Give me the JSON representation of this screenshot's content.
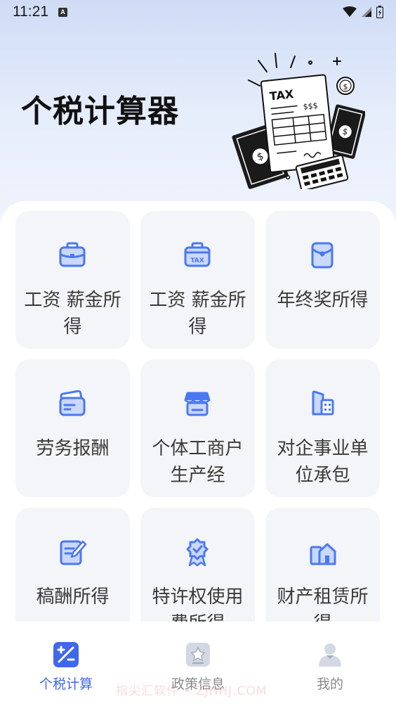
{
  "status_bar": {
    "time": "11:21",
    "notification_icon": "A"
  },
  "header": {
    "title": "个税计算器"
  },
  "illustration": {
    "tax_text": "TAX",
    "dollar_text": "$$$"
  },
  "categories": [
    {
      "label": "工资 薪金所得",
      "icon": "briefcase-icon"
    },
    {
      "label": "工资 薪金所得",
      "icon": "tax-briefcase-icon"
    },
    {
      "label": "年终奖所得",
      "icon": "red-envelope-icon"
    },
    {
      "label": "劳务报酬",
      "icon": "wallet-card-icon"
    },
    {
      "label": "个体工商户生产经",
      "icon": "storefront-icon"
    },
    {
      "label": "对企事业单位承包",
      "icon": "building-icon"
    },
    {
      "label": "稿酬所得",
      "icon": "document-edit-icon"
    },
    {
      "label": "特许权使用费所得",
      "icon": "award-badge-icon"
    },
    {
      "label": "财产租赁所得",
      "icon": "house-rental-icon"
    }
  ],
  "bottom_nav": [
    {
      "label": "个税计算",
      "icon": "calculator-icon",
      "active": true
    },
    {
      "label": "政策信息",
      "icon": "policy-star-icon",
      "active": false
    },
    {
      "label": "我的",
      "icon": "profile-icon",
      "active": false
    }
  ],
  "watermark": "指尖汇软件 • ZJHHJ.COM",
  "colors": {
    "accent": "#3f68ea",
    "icon_blue": "#4a78f0",
    "icon_light": "#c9d8fb",
    "tile_bg": "#f4f5f8",
    "inactive": "#8a8a8a"
  }
}
